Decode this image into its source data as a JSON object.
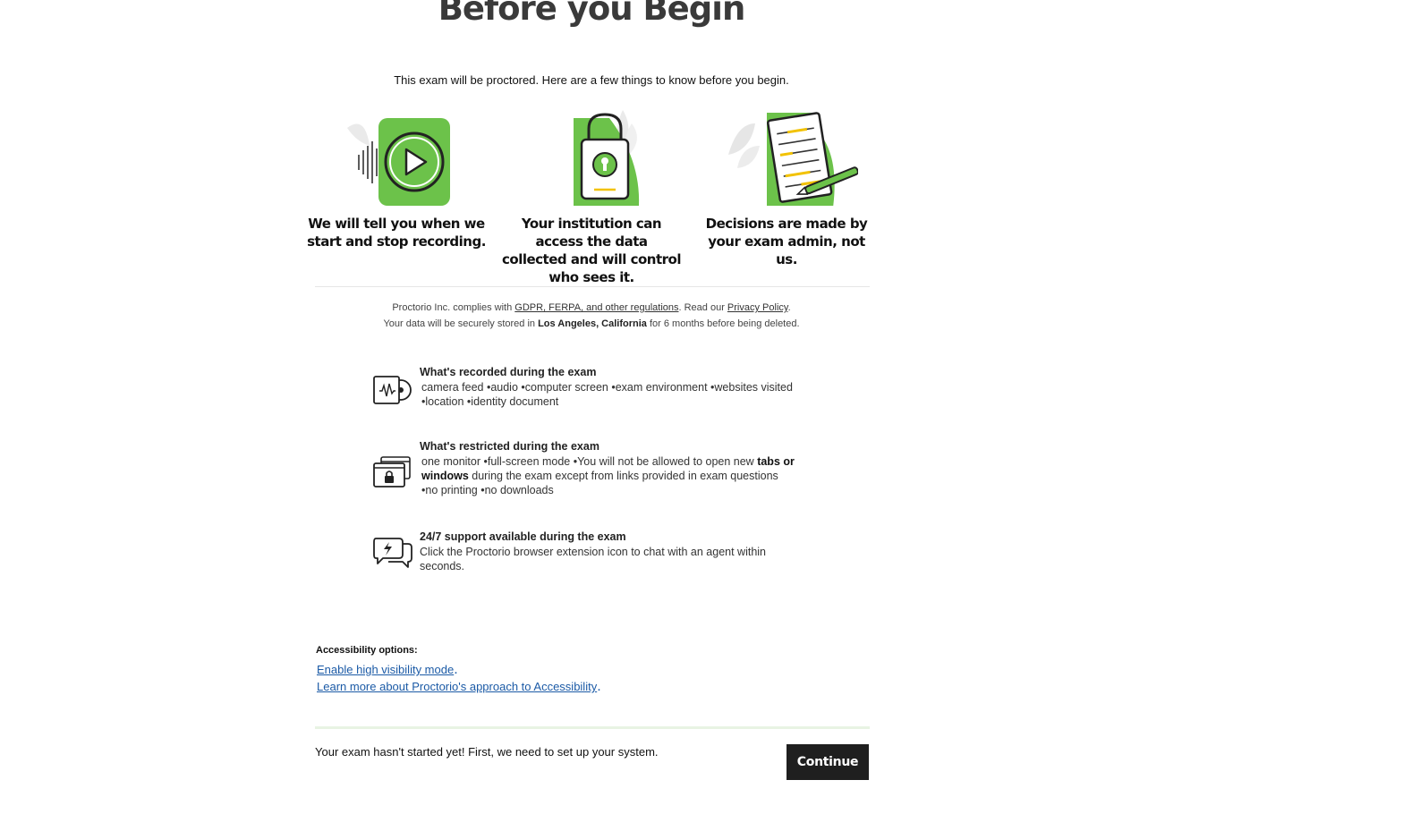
{
  "header": {
    "title": "Before you Begin",
    "intro": "This exam will be proctored. Here are a few things to know before you begin."
  },
  "cards": [
    {
      "icon": "recording-play-icon",
      "text": "We will tell you when we start and stop recording."
    },
    {
      "icon": "padlock-icon",
      "text": "Your institution can access the data collected and will control who sees it."
    },
    {
      "icon": "document-pen-icon",
      "text": "Decisions are made by your exam admin, not us."
    }
  ],
  "compliance": {
    "prefix": "Proctorio Inc. complies with ",
    "regulations_link": "GDPR, FERPA, and other regulations",
    "middle": ". Read our ",
    "privacy_link": "Privacy Policy",
    "suffix": ".",
    "storage_prefix": "Your data will be securely stored in ",
    "storage_location": "Los Angeles, California",
    "storage_suffix": " for 6 months before being deleted."
  },
  "info": {
    "recorded": {
      "title": "What's recorded during the exam",
      "text": "camera feed •audio •computer screen •exam environment •websites visited •location •identity document"
    },
    "restricted": {
      "title": "What's restricted during the exam",
      "text_a": "one monitor •full-screen mode •You will not be allowed to open new ",
      "bold": "tabs or windows",
      "text_b": " during the exam except from links provided in exam questions",
      "text_c": " •no printing •no downloads"
    },
    "support": {
      "title": "24/7 support available during the exam",
      "text": "Click the Proctorio browser extension icon to chat with an agent within seconds."
    }
  },
  "accessibility": {
    "title": "Accessibility options:",
    "link1": "Enable high visibility mode",
    "link2": "Learn more about Proctorio's approach to Accessibility",
    "period": "."
  },
  "footer": {
    "status": "Your exam hasn't started yet! First, we need to set up your system.",
    "continue_label": "Continue"
  },
  "colors": {
    "accent_green": "#6cc24a",
    "dark_button": "#1f1f1f",
    "link_blue": "#1b5aa6",
    "highlight_yellow": "#f2c200"
  }
}
